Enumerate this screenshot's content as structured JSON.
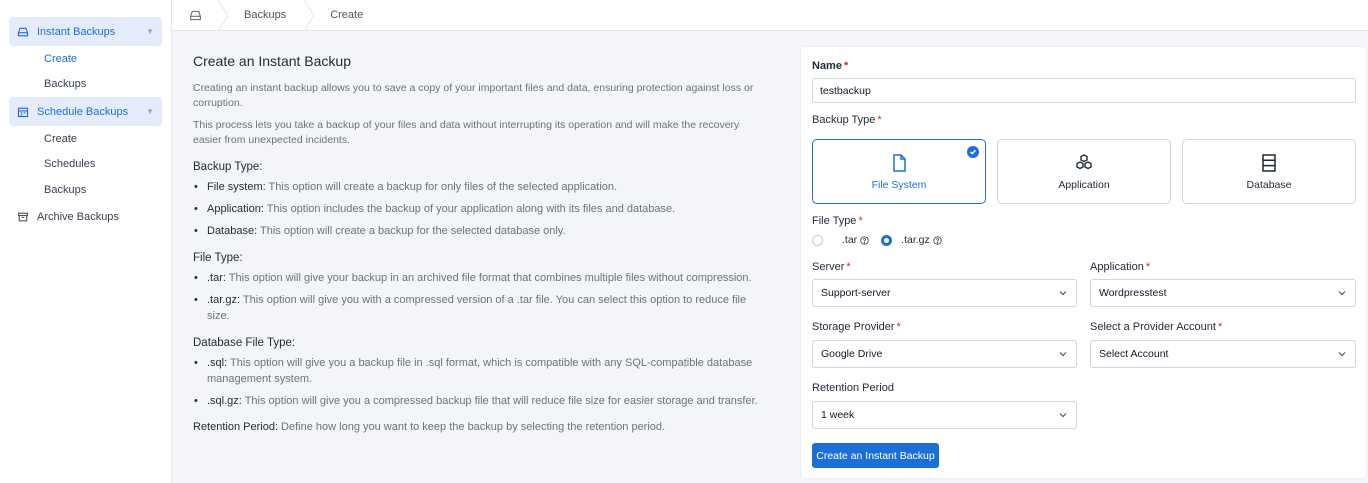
{
  "sidebar": {
    "instant": {
      "label": "Instant Backups",
      "items": [
        "Create",
        "Backups"
      ]
    },
    "schedule": {
      "label": "Schedule Backups",
      "items": [
        "Create",
        "Schedules",
        "Backups"
      ]
    },
    "archive": {
      "label": "Archive Backups"
    }
  },
  "breadcrumb": [
    "Backups",
    "Create"
  ],
  "info": {
    "title": "Create an Instant Backup",
    "intro1": "Creating an instant backup allows you to save a copy of your important files and data, ensuring protection against loss or corruption.",
    "intro2": "This process lets you take a backup of your files and data without interrupting its operation and will make the recovery easier from unexpected incidents.",
    "backup_type_heading": "Backup Type:",
    "backup_types": [
      {
        "term": "File system:",
        "desc": " This option will create a backup for only files of the selected application."
      },
      {
        "term": "Application:",
        "desc": " This option includes the backup of your application along with its files and database."
      },
      {
        "term": "Database:",
        "desc": " This option will create a backup for the selected database only."
      }
    ],
    "file_type_heading": "File Type:",
    "file_types": [
      {
        "term": ".tar:",
        "desc": " This option will give your backup in an archived file format that combines multiple files without compression."
      },
      {
        "term": ".tar.gz:",
        "desc": " This option will give you with a compressed version of a .tar file. You can select this option to reduce file size."
      }
    ],
    "db_file_type_heading": "Database File Type:",
    "db_file_types": [
      {
        "term": ".sql:",
        "desc": " This option will give you a backup file in .sql format, which is compatible with any SQL-compatible database management system."
      },
      {
        "term": ".sql.gz:",
        "desc": " This option will give you a compressed backup file that will reduce file size for easier storage and transfer."
      }
    ],
    "retention": {
      "term": "Retention Period:",
      "desc": " Define how long you want to keep the backup by selecting the retention period."
    }
  },
  "form": {
    "name_label": "Name",
    "name_value": "testbackup",
    "backup_type_label": "Backup Type",
    "tiles": [
      "File System",
      "Application",
      "Database"
    ],
    "file_type_label": "File Type",
    "file_type_options": [
      ".tar",
      ".tar.gz"
    ],
    "file_type_selected": ".tar.gz",
    "server_label": "Server",
    "server_value": "Support-server",
    "application_label": "Application",
    "application_value": "Wordpresstest",
    "storage_label": "Storage Provider",
    "storage_value": "Google Drive",
    "account_label": "Select a Provider Account",
    "account_value": "Select Account",
    "retention_label": "Retention Period",
    "retention_value": "1 week",
    "submit_label": "Create an Instant Backup",
    "required_mark": "*"
  },
  "colors": {
    "accent": "#1d6fd8",
    "required": "#dc2626"
  }
}
